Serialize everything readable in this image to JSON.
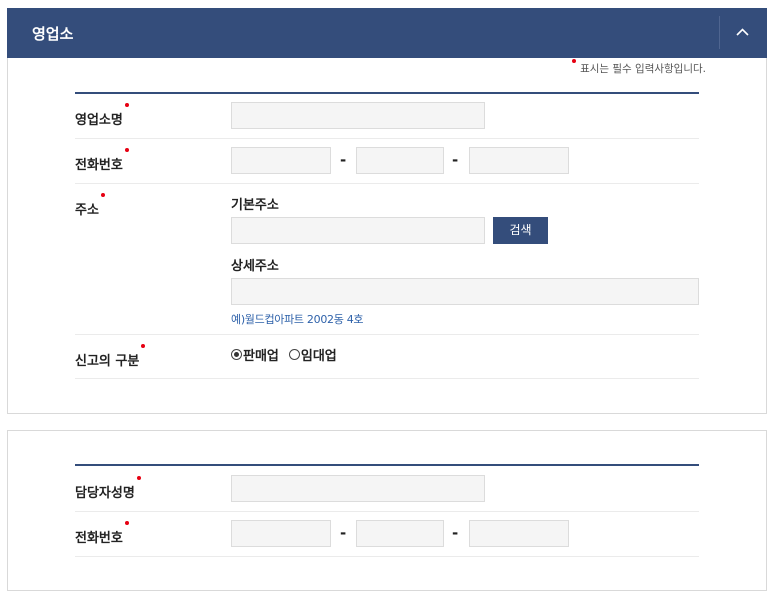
{
  "section1": {
    "title": "영업소",
    "required_note": "표시는 필수 입력사항입니다.",
    "fields": {
      "office_name_label": "영업소명",
      "phone_label": "전화번호",
      "address_label": "주소",
      "basic_address_label": "기본주소",
      "search_label": "검색",
      "detail_address_label": "상세주소",
      "address_example": "예)월드컵아파트 2002동 4호",
      "report_type_label": "신고의 구분",
      "report_type_options": [
        "판매업",
        "임대업"
      ],
      "report_type_selected": "판매업"
    },
    "dash": "-"
  },
  "section2": {
    "fields": {
      "manager_name_label": "담당자성명",
      "phone_label": "전화번호"
    },
    "dash": "-"
  },
  "icons": {
    "collapse": "chevron-up-icon",
    "required": "required-dot-icon",
    "radio": "radio-icon"
  },
  "colors": {
    "header": "#344d7b",
    "accent_rule": "#344d7b",
    "required": "#e60012",
    "example_link": "#2f62aa",
    "input_bg": "#f5f5f5"
  }
}
